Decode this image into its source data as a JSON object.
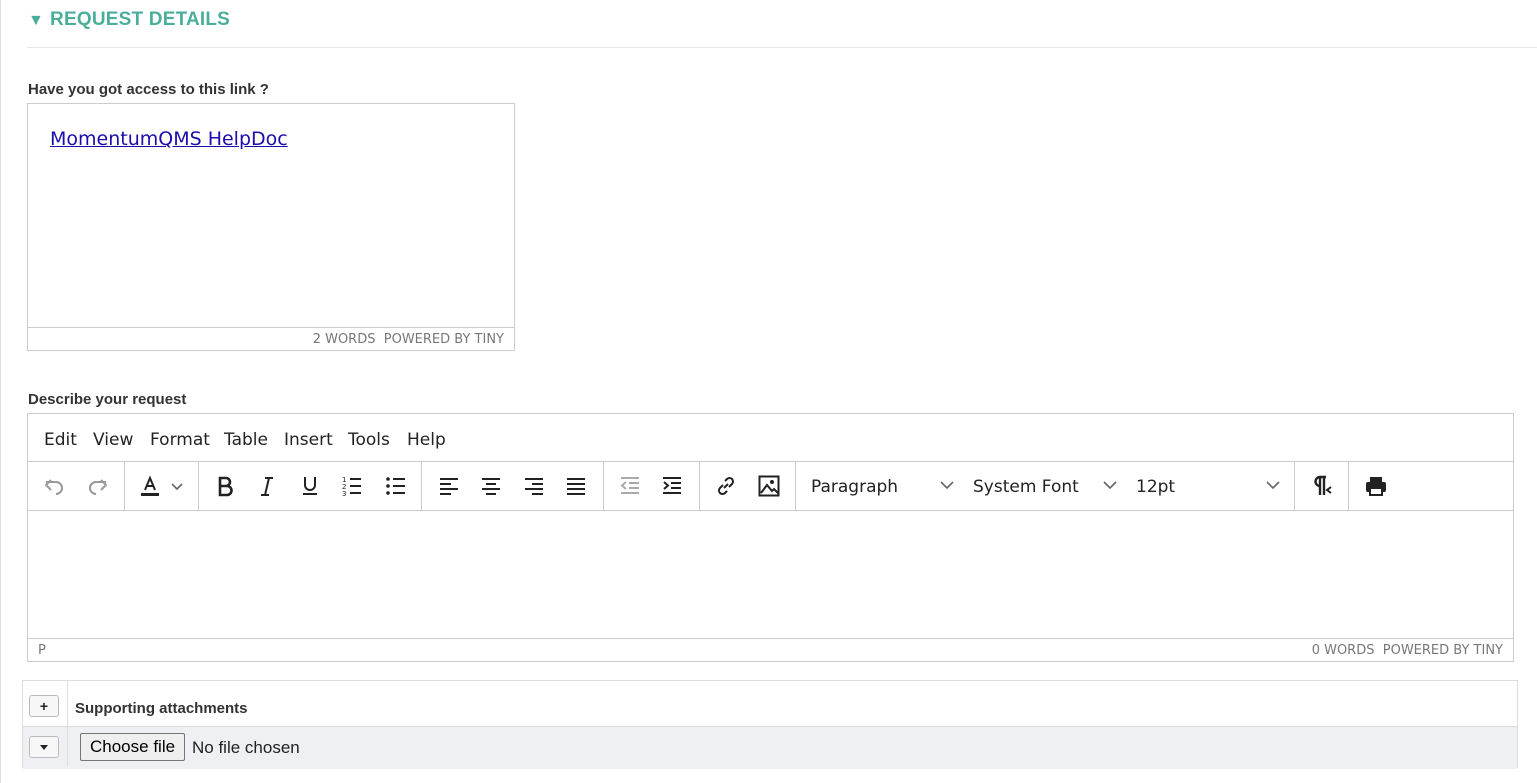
{
  "section": {
    "title": "REQUEST DETAILS",
    "toggle_icon": "▼"
  },
  "link_question": {
    "label": "Have you got access to this link ?",
    "link_text": "MomentumQMS HelpDoc",
    "word_count": "2 WORDS",
    "powered_by": "POWERED BY TINY"
  },
  "describe": {
    "label": "Describe your request",
    "menu": [
      "Edit",
      "View",
      "Format",
      "Table",
      "Insert",
      "Tools",
      "Help"
    ],
    "block_format": "Paragraph",
    "font_family": "System Font",
    "font_size": "12pt",
    "path": "P",
    "word_count": "0 WORDS",
    "powered_by": "POWERED BY TINY"
  },
  "attachments": {
    "title": "Supporting attachments",
    "add_label": "+",
    "choose_label": "Choose file",
    "no_file_text": "No file chosen"
  },
  "colors": {
    "accent": "#4aae9b",
    "link": "#1a0dab"
  }
}
